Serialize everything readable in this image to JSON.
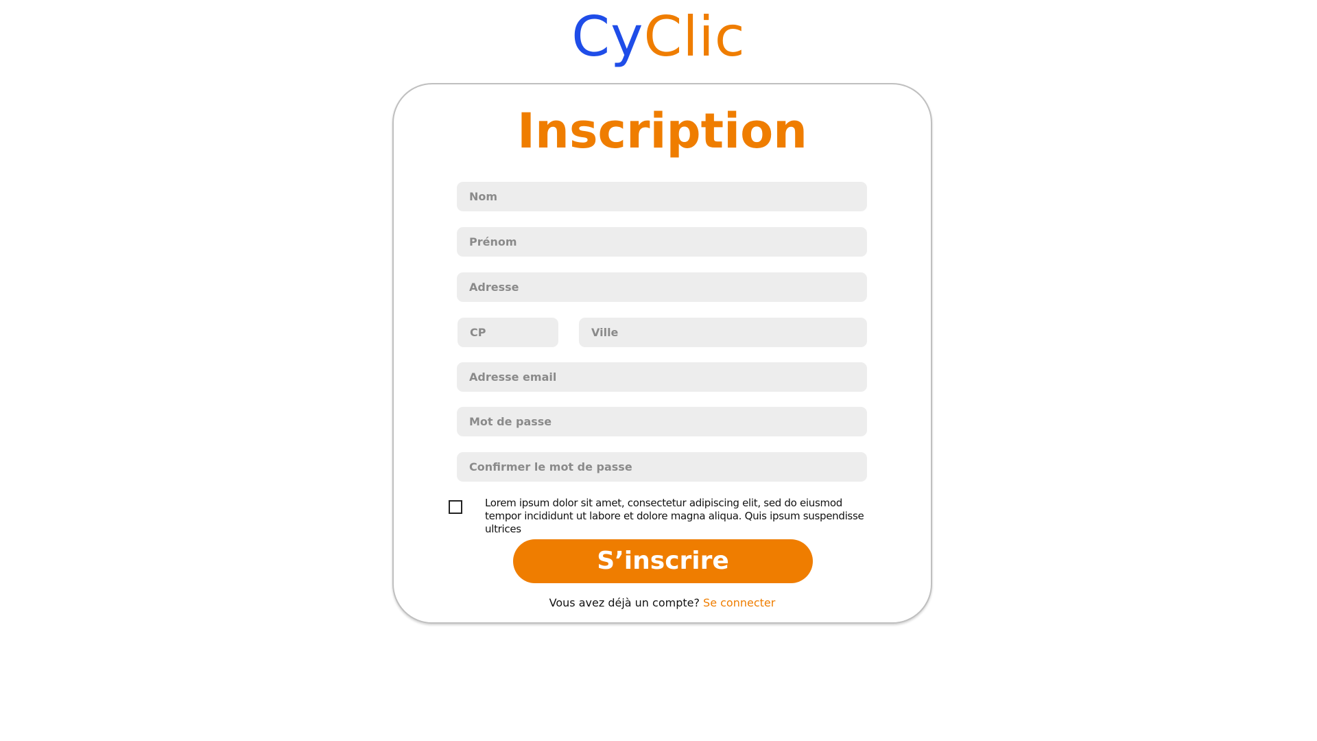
{
  "logo": {
    "part_a": "Cy",
    "part_b": "Clic",
    "color_a": "#1f4de8",
    "color_b": "#ef7d00"
  },
  "form": {
    "title": "Inscription",
    "fields": {
      "nom": {
        "placeholder": "Nom",
        "value": ""
      },
      "prenom": {
        "placeholder": "Prénom",
        "value": ""
      },
      "adresse": {
        "placeholder": "Adresse",
        "value": ""
      },
      "cp": {
        "placeholder": "CP",
        "value": ""
      },
      "ville": {
        "placeholder": "Ville",
        "value": ""
      },
      "email": {
        "placeholder": "Adresse email",
        "value": ""
      },
      "password": {
        "placeholder": "Mot de passe",
        "value": ""
      },
      "password_confirm": {
        "placeholder": "Confirmer le mot de passe",
        "value": ""
      }
    },
    "terms": {
      "checked": false,
      "text": "Lorem ipsum dolor sit amet, consectetur adipiscing elit, sed do eiusmod tempor incididunt ut labore et dolore magna aliqua. Quis ipsum suspendisse ultrices"
    },
    "submit_label": "S’inscrire",
    "login_prompt": "Vous avez déjà un compte?",
    "login_link": "Se connecter"
  },
  "colors": {
    "accent": "#ef7d00",
    "brand_blue": "#1f4de8",
    "field_bg": "#ededed",
    "card_border": "#bfbfbf"
  }
}
